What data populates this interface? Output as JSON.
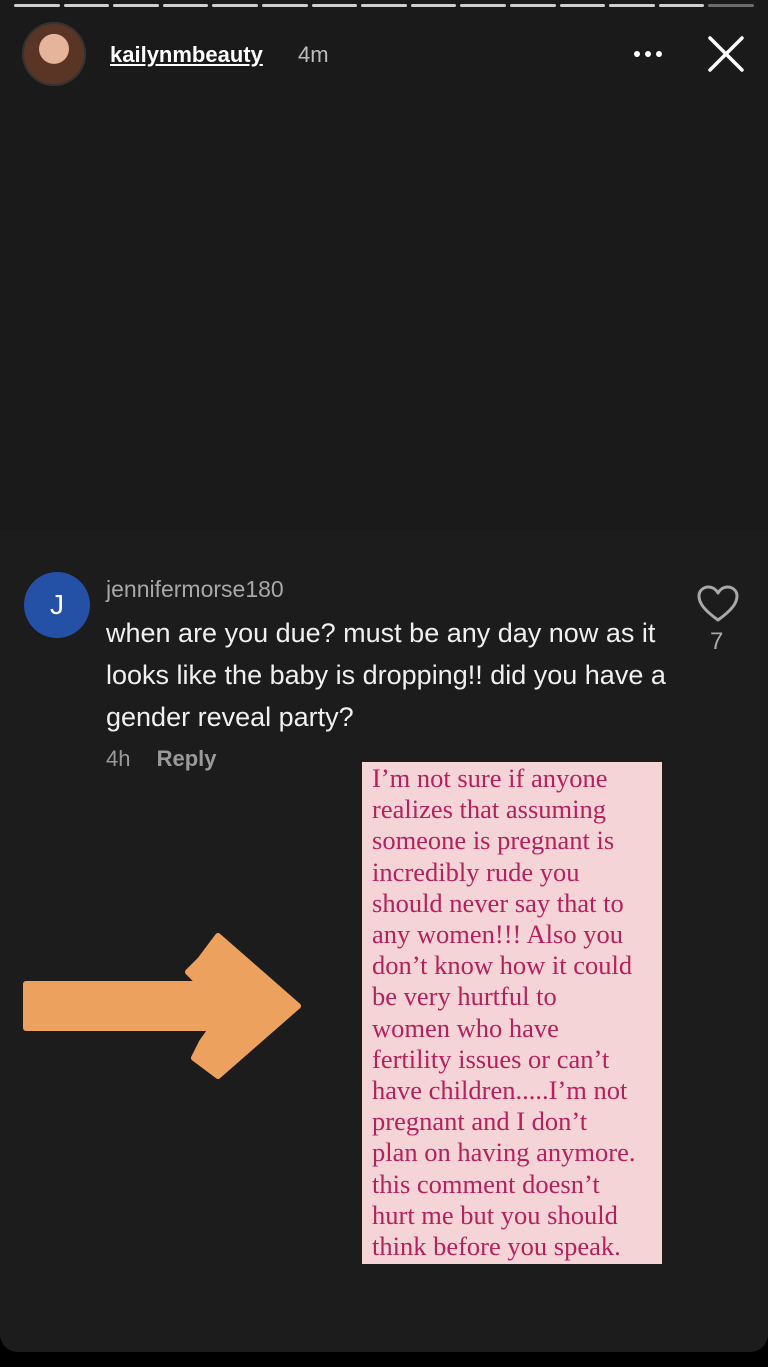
{
  "header": {
    "username": "kailynmbeauty",
    "time": "4m",
    "progress_segments": 15
  },
  "comment": {
    "avatar_letter": "J",
    "username": "jennifermorse180",
    "text": "when are you due? must be any day now as it looks like the baby is dropping!! did you have a gender reveal party?",
    "time": "4h",
    "reply_label": "Reply",
    "like_count": "7"
  },
  "note": {
    "text": "I’m not sure if anyone\nrealizes that assuming\nsomeone is pregnant is\nincredibly rude you\nshould never say that to\nany women!!! Also you\ndon’t know how it could\nbe very hurtful to\nwomen who have\nfertility issues or can’t\nhave children.....I’m not\npregnant and I don’t\nplan on having anymore.\nthis comment doesn’t\nhurt me but you should\nthink before you speak."
  },
  "colors": {
    "background": "#1a1a1a",
    "avatar_blue": "#2450a6",
    "arrow_orange": "#eda15e",
    "note_bg": "#f5d4d8",
    "note_text": "#b5215c"
  }
}
